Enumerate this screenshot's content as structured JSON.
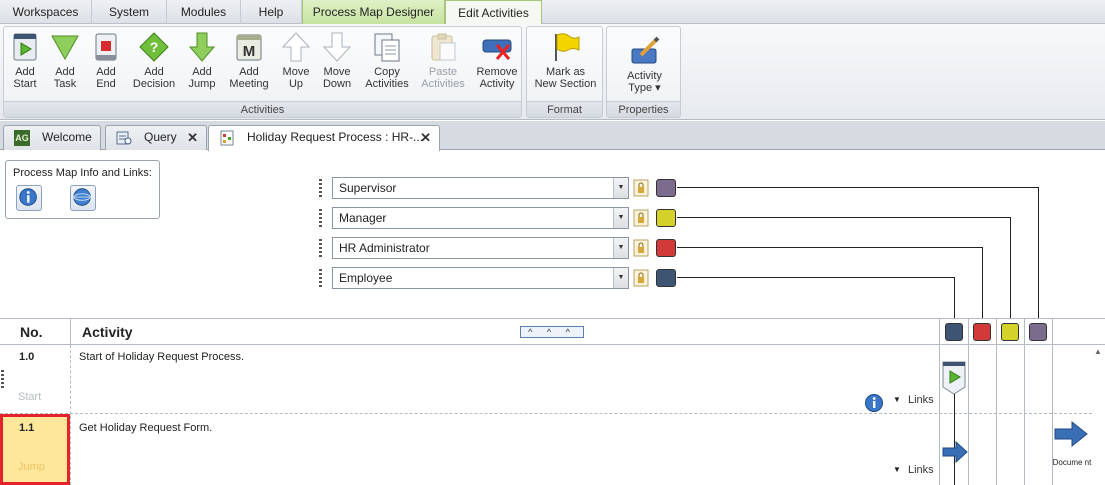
{
  "menu": {
    "tabs": [
      "Workspaces",
      "System",
      "Modules",
      "Help"
    ],
    "context_tabs": [
      "Process Map Designer",
      "Edit Activities"
    ]
  },
  "ribbon": {
    "activities_group": {
      "label": "Activities",
      "buttons": [
        {
          "line1": "Add",
          "line2": "Start",
          "icon": "add-start-icon"
        },
        {
          "line1": "Add",
          "line2": "Task",
          "icon": "add-task-icon"
        },
        {
          "line1": "Add",
          "line2": "End",
          "icon": "add-end-icon"
        },
        {
          "line1": "Add",
          "line2": "Decision",
          "icon": "add-decision-icon"
        },
        {
          "line1": "Add",
          "line2": "Jump",
          "icon": "add-jump-icon"
        },
        {
          "line1": "Add",
          "line2": "Meeting",
          "icon": "add-meeting-icon"
        },
        {
          "line1": "Move",
          "line2": "Up",
          "icon": "move-up-icon"
        },
        {
          "line1": "Move",
          "line2": "Down",
          "icon": "move-down-icon"
        },
        {
          "line1": "Copy",
          "line2": "Activities",
          "icon": "copy-icon"
        },
        {
          "line1": "Paste",
          "line2": "Activities",
          "icon": "paste-icon"
        },
        {
          "line1": "Remove",
          "line2": "Activity",
          "icon": "remove-icon"
        }
      ]
    },
    "format_group": {
      "label": "Format",
      "button": {
        "line1": "Mark as",
        "line2": "New Section",
        "icon": "flag-icon"
      }
    },
    "properties_group": {
      "label": "Properties",
      "button": {
        "line1": "Activity",
        "line2": "Type ▾",
        "icon": "pencil-icon"
      }
    }
  },
  "doc_tabs": [
    {
      "label": "Welcome",
      "icon": "ag-logo-icon"
    },
    {
      "label": "Query",
      "icon": "query-icon"
    },
    {
      "label": "Holiday Request Process : HR-...",
      "icon": "process-map-icon"
    }
  ],
  "info_box": {
    "title": "Process Map Info and Links:"
  },
  "roles": [
    {
      "name": "Supervisor",
      "color": "#7b6b8c"
    },
    {
      "name": "Manager",
      "color": "#d4d22a"
    },
    {
      "name": "HR Administrator",
      "color": "#d23a3a"
    },
    {
      "name": "Employee",
      "color": "#3d5473"
    }
  ],
  "grid": {
    "col_no": "No.",
    "col_activity": "Activity",
    "collapse": "^ ^ ^",
    "rows": [
      {
        "no": "1.0",
        "description": "Start of Holiday Request Process.",
        "type": "Start",
        "links": "Links"
      },
      {
        "no": "1.1",
        "description": "Get Holiday Request Form.",
        "type": "Jump",
        "links": "Links",
        "jump_target": "Docume nt"
      }
    ]
  },
  "colors": {
    "accent_green": "#c7e3a0",
    "highlight_red": "#e4222b"
  }
}
